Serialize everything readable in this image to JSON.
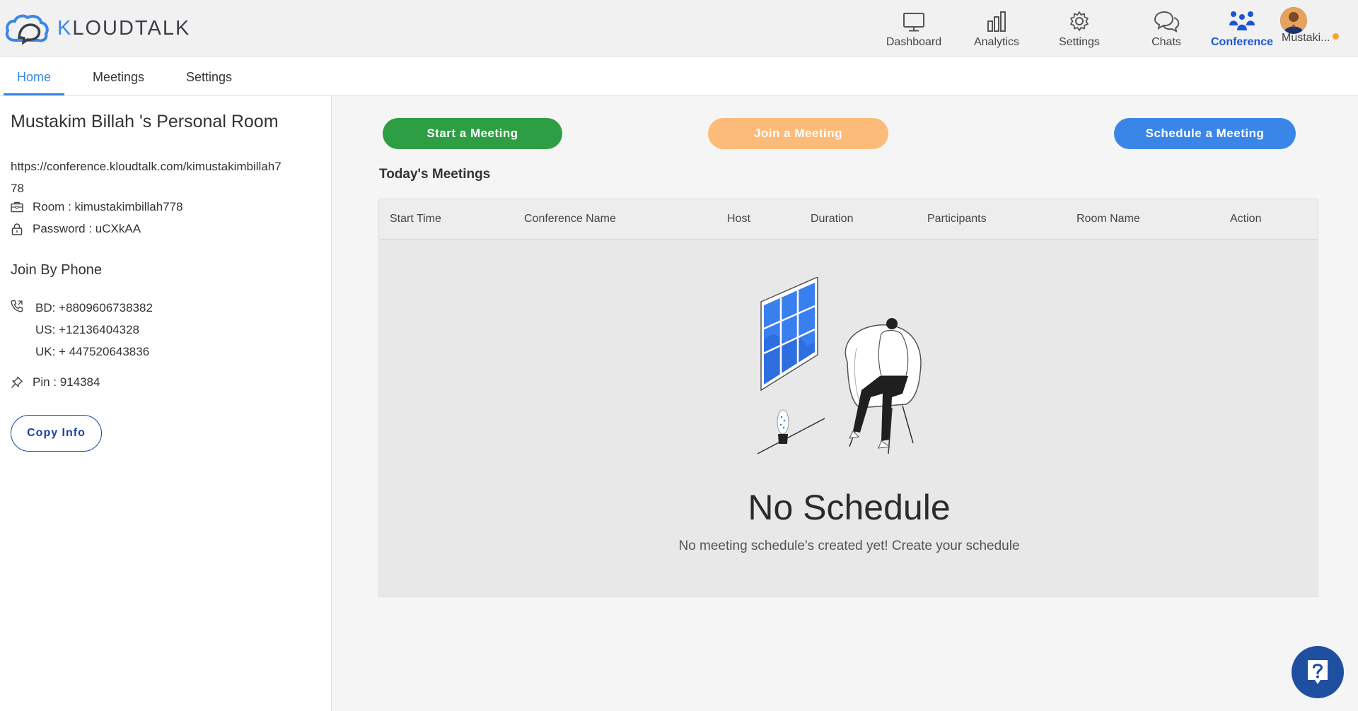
{
  "app": {
    "logo_text_prefix": "K",
    "logo_text_rest": "LOUDTALK"
  },
  "topnav": {
    "items": [
      {
        "label": "Dashboard",
        "icon": "monitor-icon"
      },
      {
        "label": "Analytics",
        "icon": "bar-chart-icon"
      },
      {
        "label": "Settings",
        "icon": "gear-icon"
      },
      {
        "label": "Chats",
        "icon": "chat-bubbles-icon"
      },
      {
        "label": "Conference",
        "icon": "people-icon",
        "active": true
      }
    ],
    "user_name": "Mustaki..."
  },
  "tabs": [
    {
      "label": "Home",
      "active": true
    },
    {
      "label": "Meetings"
    },
    {
      "label": "Settings"
    }
  ],
  "sidebar": {
    "room_title": "Mustakim Billah 's Personal Room",
    "room_url": "https://conference.kloudtalk.com/kimustakimbillah778",
    "room": "Room : kimustakimbillah778",
    "password": "Password : uCXkAA",
    "join_by_phone": "Join By Phone",
    "phones": [
      "BD: +8809606738382",
      "US: +12136404328",
      "UK: + 447520643836"
    ],
    "pin": "Pin : 914384",
    "copy_info": "Copy Info"
  },
  "main": {
    "start_meeting": "Start a Meeting",
    "join_meeting": "Join a Meeting",
    "schedule_meeting": "Schedule a Meeting",
    "today_title": "Today's Meetings",
    "columns": [
      "Start Time",
      "Conference Name",
      "Host",
      "Duration",
      "Participants",
      "Room Name",
      "Action"
    ],
    "empty_title": "No Schedule",
    "empty_subtitle": "No meeting schedule's created yet! Create your schedule"
  },
  "colors": {
    "brand": "#3a86e8",
    "start": "#2e9e44",
    "join": "#fdbb79",
    "schedule": "#3a86e8",
    "help": "#1f4fa1"
  }
}
